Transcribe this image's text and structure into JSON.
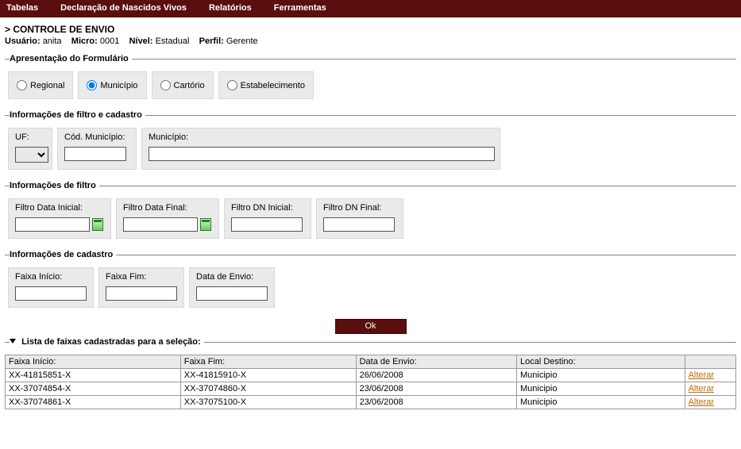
{
  "menu": {
    "tabelas": "Tabelas",
    "declaracao": "Declaração de Nascidos Vivos",
    "relatorios": "Relatórios",
    "ferramentas": "Ferramentas"
  },
  "heading": "> CONTROLE DE ENVIO",
  "userline": {
    "usuario_label": "Usuário:",
    "usuario_value": "anita",
    "micro_label": "Micro:",
    "micro_value": "0001",
    "nivel_label": "Nível:",
    "nivel_value": "Estadual",
    "perfil_label": "Perfil:",
    "perfil_value": "Gerente"
  },
  "apresentacao": {
    "legend": "Apresentação do Formulário",
    "regional": "Regional",
    "municipio": "Município",
    "cartorio": "Cartório",
    "estabelecimento": "Estabelecimento"
  },
  "filtro_cadastro": {
    "legend": "Informações de filtro e cadastro",
    "uf_label": "UF:",
    "codmun_label": "Cód. Município:",
    "municipio_label": "Município:"
  },
  "filtro": {
    "legend": "Informações de filtro",
    "data_ini_label": "Filtro Data Inicial:",
    "data_fim_label": "Filtro Data Final:",
    "dn_ini_label": "Filtro DN Inicial:",
    "dn_fim_label": "Filtro DN Final:"
  },
  "cadastro": {
    "legend": "Informações de cadastro",
    "faixa_ini_label": "Faixa Início:",
    "faixa_fim_label": "Faixa Fim:",
    "data_envio_label": "Data de Envio:"
  },
  "ok_label": "Ok",
  "lista": {
    "legend": "Lista de faixas cadastradas para a seleção:",
    "col_faixa_ini": "Faixa Início:",
    "col_faixa_fim": "Faixa Fim:",
    "col_data_envio": "Data de Envio:",
    "col_local": "Local Destino:",
    "action_label": "Alterar",
    "rows": [
      {
        "ini": "XX-41815851-X",
        "fim": "XX-41815910-X",
        "data": "26/06/2008",
        "local": "Municipio"
      },
      {
        "ini": "XX-37074854-X",
        "fim": "XX-37074860-X",
        "data": "23/06/2008",
        "local": "Municipio"
      },
      {
        "ini": "XX-37074861-X",
        "fim": "XX-37075100-X",
        "data": "23/06/2008",
        "local": "Municipio"
      }
    ]
  }
}
